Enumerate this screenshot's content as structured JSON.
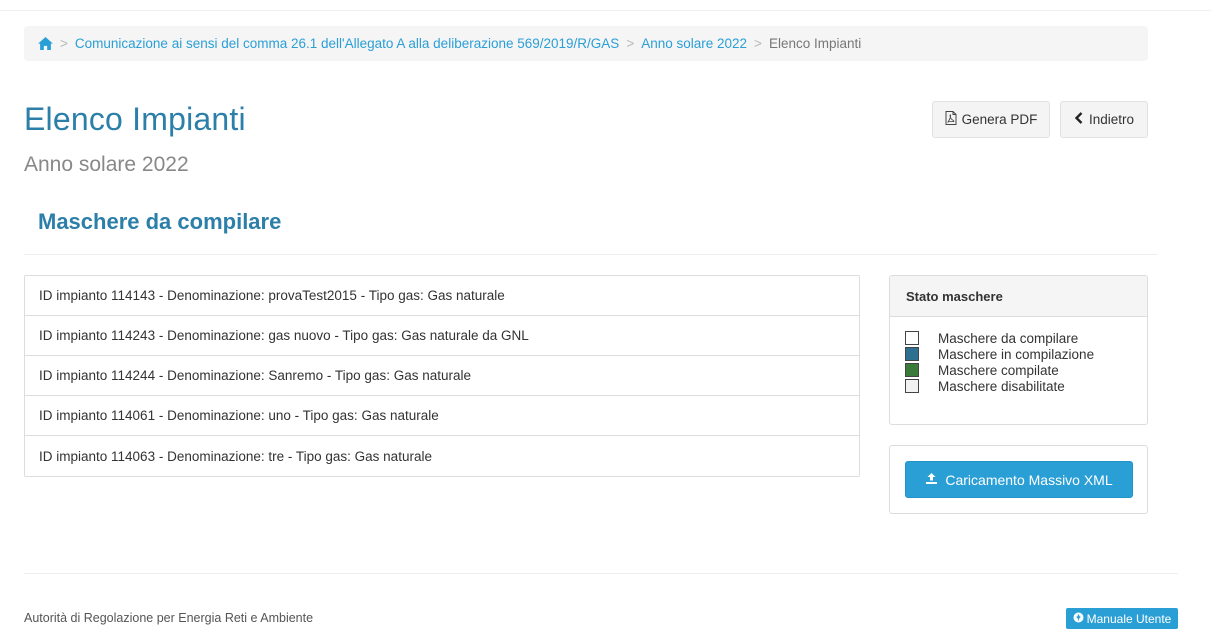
{
  "breadcrumb": {
    "items": [
      "Comunicazione ai sensi del comma 26.1 dell'Allegato A alla deliberazione 569/2019/R/GAS",
      "Anno solare 2022"
    ],
    "current": "Elenco Impianti",
    "separator": ">"
  },
  "header": {
    "title": "Elenco Impianti",
    "subtitle": "Anno solare 2022",
    "pdf_label": "Genera PDF",
    "back_label": "Indietro"
  },
  "section": {
    "title": "Maschere da compilare"
  },
  "impianti": [
    "ID impianto 114143 - Denominazione: provaTest2015 - Tipo gas: Gas naturale",
    "ID impianto 114243 - Denominazione: gas nuovo - Tipo gas: Gas naturale da GNL",
    "ID impianto 114244 - Denominazione: Sanremo - Tipo gas: Gas naturale",
    "ID impianto 114061 - Denominazione: uno - Tipo gas: Gas naturale",
    "ID impianto 114063 - Denominazione: tre - Tipo gas: Gas naturale"
  ],
  "stato_panel": {
    "title": "Stato maschere",
    "legend": [
      {
        "label": "Maschere da compilare",
        "color": "#ffffff"
      },
      {
        "label": "Maschere in compilazione",
        "color": "#2f6f8f"
      },
      {
        "label": "Maschere compilate",
        "color": "#3a7a3a"
      },
      {
        "label": "Maschere disabilitate",
        "color": "#f2f2f2"
      }
    ]
  },
  "upload": {
    "label": "Caricamento Massivo XML"
  },
  "footer": {
    "text": "Autorità di Regolazione per Energia Reti e Ambiente",
    "manual_label": "Manuale Utente"
  },
  "colors": {
    "accent": "#2a9fd6",
    "title": "#2c7fa8"
  },
  "icons": [
    "home-icon",
    "pdf-icon",
    "chevron-left-icon",
    "upload-icon",
    "info-circle-icon"
  ]
}
